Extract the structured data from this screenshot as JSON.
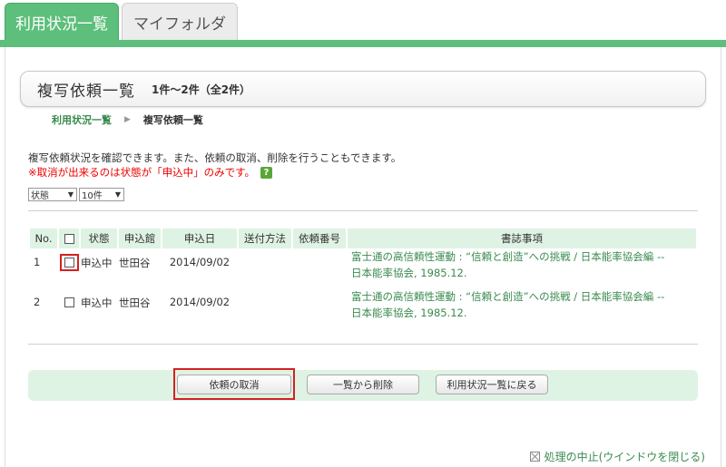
{
  "tabs": [
    {
      "label": "利用状況一覧",
      "active": true
    },
    {
      "label": "マイフォルダ",
      "active": false
    }
  ],
  "header": {
    "title": "複写依頼一覧",
    "count": "1件～2件（全2件）"
  },
  "breadcrumb": {
    "parent": "利用状況一覧",
    "separator": "▶",
    "current": "複写依頼一覧"
  },
  "description": "複写依頼状況を確認できます。また、依頼の取消、削除を行うこともできます。",
  "warning": "※取消が出来るのは状態が「申込中」のみです。",
  "help_icon": "?",
  "filters": {
    "status_select": "状態",
    "count_select": "10件"
  },
  "table": {
    "columns": [
      "No.",
      "",
      "状態",
      "申込館",
      "申込日",
      "送付方法",
      "依頼番号",
      "書誌事項"
    ],
    "rows": [
      {
        "no": "1",
        "status": "申込中",
        "library": "世田谷",
        "date": "2014/09/02",
        "delivery": "",
        "request_no": "",
        "biblio_line1": "富士通の高信頼性運動 : “信頼と創造”への挑戦 / 日本能率協会編 --",
        "biblio_line2": "日本能率協会, 1985.12."
      },
      {
        "no": "2",
        "status": "申込中",
        "library": "世田谷",
        "date": "2014/09/02",
        "delivery": "",
        "request_no": "",
        "biblio_line1": "富士通の高信頼性運動 : “信頼と創造”への挑戦 / 日本能率協会編 --",
        "biblio_line2": "日本能率協会, 1985.12."
      }
    ]
  },
  "actions": {
    "cancel": "依頼の取消",
    "delete": "一覧から削除",
    "back": "利用状況一覧に戻る"
  },
  "footer": {
    "close_link": "処理の中止(ウインドウを閉じる)"
  },
  "colors": {
    "accent_green": "#5dbf7b",
    "link_green": "#3a8a4f",
    "highlight_red": "#d62020",
    "warning_red": "#e00000"
  }
}
